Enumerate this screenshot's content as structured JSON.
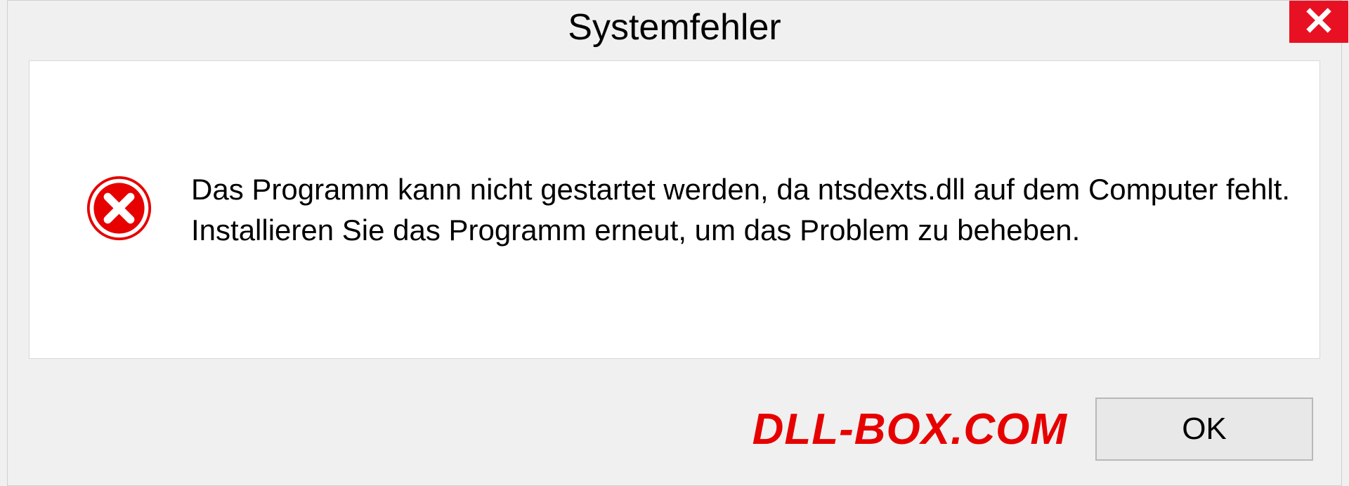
{
  "dialog": {
    "title": "Systemfehler",
    "message": "Das Programm kann nicht gestartet werden, da ntsdexts.dll auf dem Computer fehlt. Installieren Sie das Programm erneut, um das Problem zu beheben.",
    "ok_label": "OK"
  },
  "watermark": "DLL-BOX.COM",
  "colors": {
    "close_red": "#e81123",
    "error_red": "#e60000",
    "watermark_red": "#e60000"
  }
}
